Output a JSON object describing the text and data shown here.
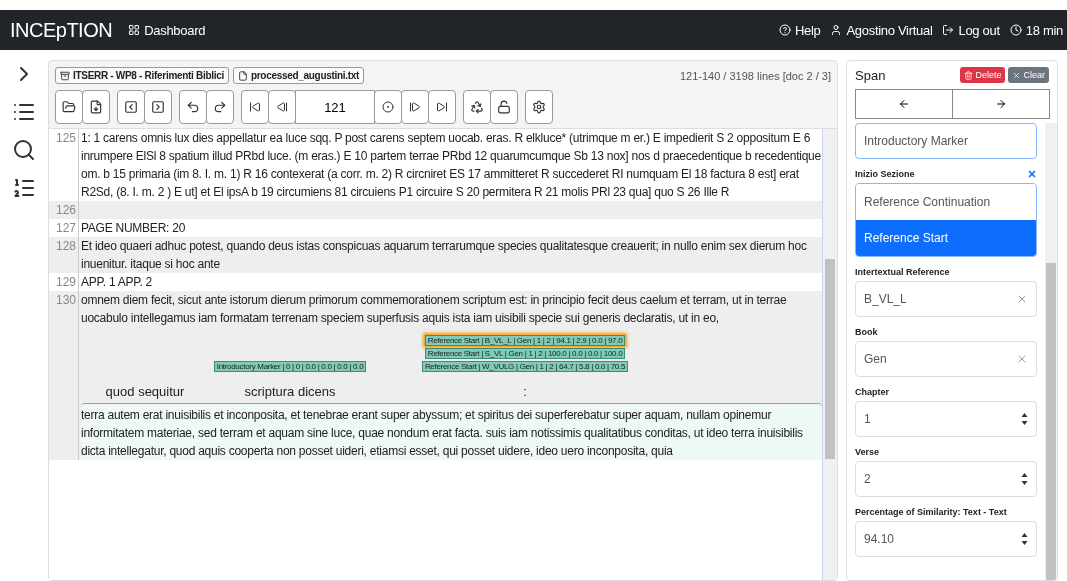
{
  "navbar": {
    "brand": "INCEpTION",
    "dashboard": "Dashboard",
    "help": "Help",
    "user": "Agostino Virtual",
    "logout": "Log out",
    "timer": "18 min"
  },
  "breadcrumbs": [
    {
      "kind": "project",
      "label": "ITSERR - WP8 - Riferimenti Biblici"
    },
    {
      "kind": "document",
      "label": "processed_augustini.txt"
    }
  ],
  "position": "121-140 / 3198 lines [doc 2 / 3]",
  "page_input": "121",
  "lines": [
    {
      "number": "125",
      "text": "1: 1 carens omnis lux dies appellatur ea luce sqq. P post carens septem uocab. eras. R elkluce* (utrimque m er.) E impedierit S 2 oppositum E 6 inrumpere ElSl 8 spatium illud PRbd luce. (m eras.) E 10 partem terrae PRbd 12 quarumcumque Sb 13 nox] nos d praecedentique b recedentique om. b 15 primaria (im 8. I. m. 1) R 16 contexerat (a corr. m. 2) R circniret ES 17 ammitteret R succederet RI numquam El 18 factura 8 est] erat R2Sd, (8. I. m. 2 ) E ut] et El ipsA b 19 circumiens 81 circuiens P1 circuire S 20 permitera R 21 molis PRl 23 qua] quo S 26 Ille R"
    },
    {
      "number": "126"
    },
    {
      "number": "127",
      "text": "PAGE NUMBER: 20"
    },
    {
      "number": "128",
      "text": "Et ideo quaeri adhuc potest, quando deus istas conspicuas aquarum terrarumque species qualitatesque creauerit; in nullo enim sex dierum hoc inuenitur. itaque si hoc ante"
    },
    {
      "number": "129",
      "text": "APP. 1 APP. 2"
    },
    {
      "number": "130",
      "text": "omnem diem fecit, sicut ante istorum dierum primorum commemorationem scriptum est: in principio fecit deus caelum et terram, ut in terrae uocabulo intellegamus iam formatam terrenam speciem superfusis aquis ista iam uisibili specie sui generis declaratis, ut in eo,",
      "segments": [
        {
          "text": "quod sequitur"
        },
        {
          "text": "scriptura dicens",
          "labels": [
            {
              "text": "Introductory Marker | 0 | 0 | 0.0 | 0.0 | 0.0 | 0.0",
              "selected": false
            }
          ]
        },
        {
          "text": ":",
          "labels": [
            {
              "text": "Reference Start | B_VL_L | Gen | 1 | 2 | 94.1 | 2.9 | 0.0 | 97.0",
              "selected": true
            },
            {
              "text": "Reference Start | S_VL | Gen | 1 | 2 | 100.0 | 0.0 | 0.0 | 100.0",
              "selected": false
            },
            {
              "text": "Reference Start | W_VULG | Gen | 1 | 2 | 64.7 | 5.8 | 0.0 | 70.5",
              "selected": false
            }
          ]
        }
      ],
      "annotated_text": "terra autem erat inuisibilis et inconposita, et tenebrae erant super abyssum; et spiritus dei superferebatur super aquam, nullam opinemur informitatem materiae, sed terram et aquam sine luce, quae nondum erat facta. suis iam notissimis qualitatibus conditas, ut ideo terra inuisibilis dicta intellegatur, quod aquis cooperta non posset uideri, etiamsi esset, qui posset uidere, ideo uero inconposita, quia"
    }
  ],
  "panel": {
    "title": "Span",
    "delete": "Delete",
    "clear": "Clear",
    "layer_field": {
      "value": "Introductory Marker",
      "focused": true
    },
    "features": [
      {
        "kind": "select",
        "label": "Inizio Sezione",
        "options": [
          {
            "label": "Reference Continuation",
            "selected": false
          },
          {
            "label": "Reference Start",
            "selected": true
          }
        ]
      },
      {
        "kind": "combo",
        "label": "Intertextual Reference",
        "value": "B_VL_L"
      },
      {
        "kind": "combo",
        "label": "Book",
        "value": "Gen"
      },
      {
        "kind": "number",
        "label": "Chapter",
        "value": "1"
      },
      {
        "kind": "number",
        "label": "Verse",
        "value": "2"
      },
      {
        "kind": "number",
        "label": "Percentage of Similarity: Text - Text",
        "value": "94.10"
      }
    ]
  }
}
